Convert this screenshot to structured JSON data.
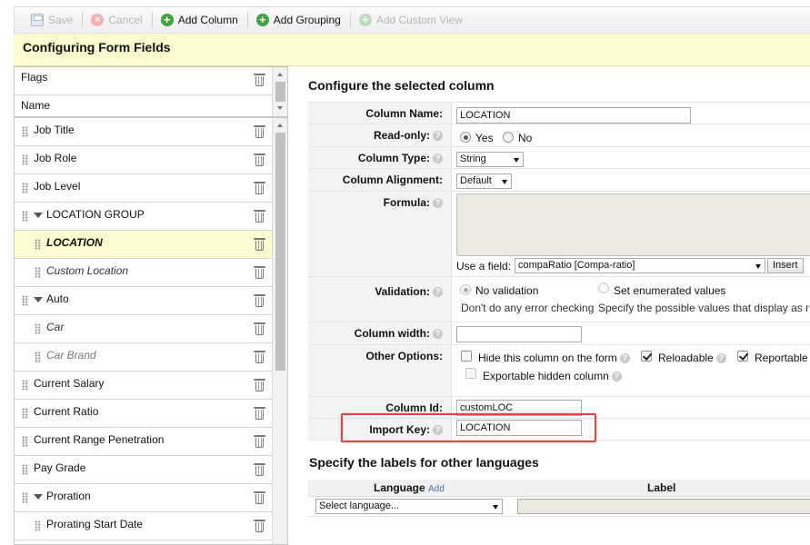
{
  "toolbar": {
    "save": "Save",
    "cancel": "Cancel",
    "add_column": "Add Column",
    "add_grouping": "Add Grouping",
    "add_custom_view": "Add Custom View"
  },
  "header": {
    "title": "Configuring Form Fields"
  },
  "left_panel": {
    "top_items": [
      "Flags",
      "Name"
    ],
    "items": [
      {
        "label": "Job Title"
      },
      {
        "label": "Job Role"
      },
      {
        "label": "Job Level"
      },
      {
        "label": "LOCATION GROUP"
      },
      {
        "label": "LOCATION"
      },
      {
        "label": "Custom Location"
      },
      {
        "label": "Auto"
      },
      {
        "label": "Car"
      },
      {
        "label": "Car Brand"
      },
      {
        "label": "Current Salary"
      },
      {
        "label": "Current Ratio"
      },
      {
        "label": "Current Range Penetration"
      },
      {
        "label": "Pay Grade"
      },
      {
        "label": "Proration"
      },
      {
        "label": "Prorating Start Date"
      }
    ]
  },
  "configure": {
    "title": "Configure the selected column",
    "column_name": {
      "label": "Column Name:",
      "value": "LOCATION"
    },
    "read_only": {
      "label": "Read-only:",
      "yes": "Yes",
      "no": "No",
      "selected": "Yes"
    },
    "column_type": {
      "label": "Column Type:",
      "value": "String"
    },
    "column_alignment": {
      "label": "Column Alignment:",
      "value": "Default"
    },
    "formula": {
      "label": "Formula:",
      "use_field_label": "Use a field:",
      "field_value": "compaRatio [Compa-ratio]",
      "insert": "Insert"
    },
    "validation": {
      "label": "Validation:",
      "opt1": "No validation",
      "opt1_desc": "Don't do any error checking",
      "opt2": "Set enumerated values",
      "opt2_desc": "Specify the possible values that display as r"
    },
    "column_width": {
      "label": "Column width:",
      "value": ""
    },
    "other_options": {
      "label": "Other Options:",
      "hide": "Hide this column on the form",
      "reloadable": "Reloadable",
      "reportable": "Reportable",
      "exportable_hidden": "Exportable hidden column"
    },
    "column_id": {
      "label": "Column Id:",
      "value": "customLOC"
    },
    "import_key": {
      "label": "Import Key:",
      "value": "LOCATION"
    },
    "help_glyph": "?"
  },
  "languages": {
    "title": "Specify the labels for other languages",
    "col_language": "Language",
    "add_link": "Add",
    "col_label": "Label",
    "select_placeholder": "Select language..."
  },
  "colors": {
    "header_bg": "#fbfbce",
    "selected_row": "#fdfbd0",
    "highlight_box": "#e04545",
    "add_icon": "#3ea43e"
  }
}
